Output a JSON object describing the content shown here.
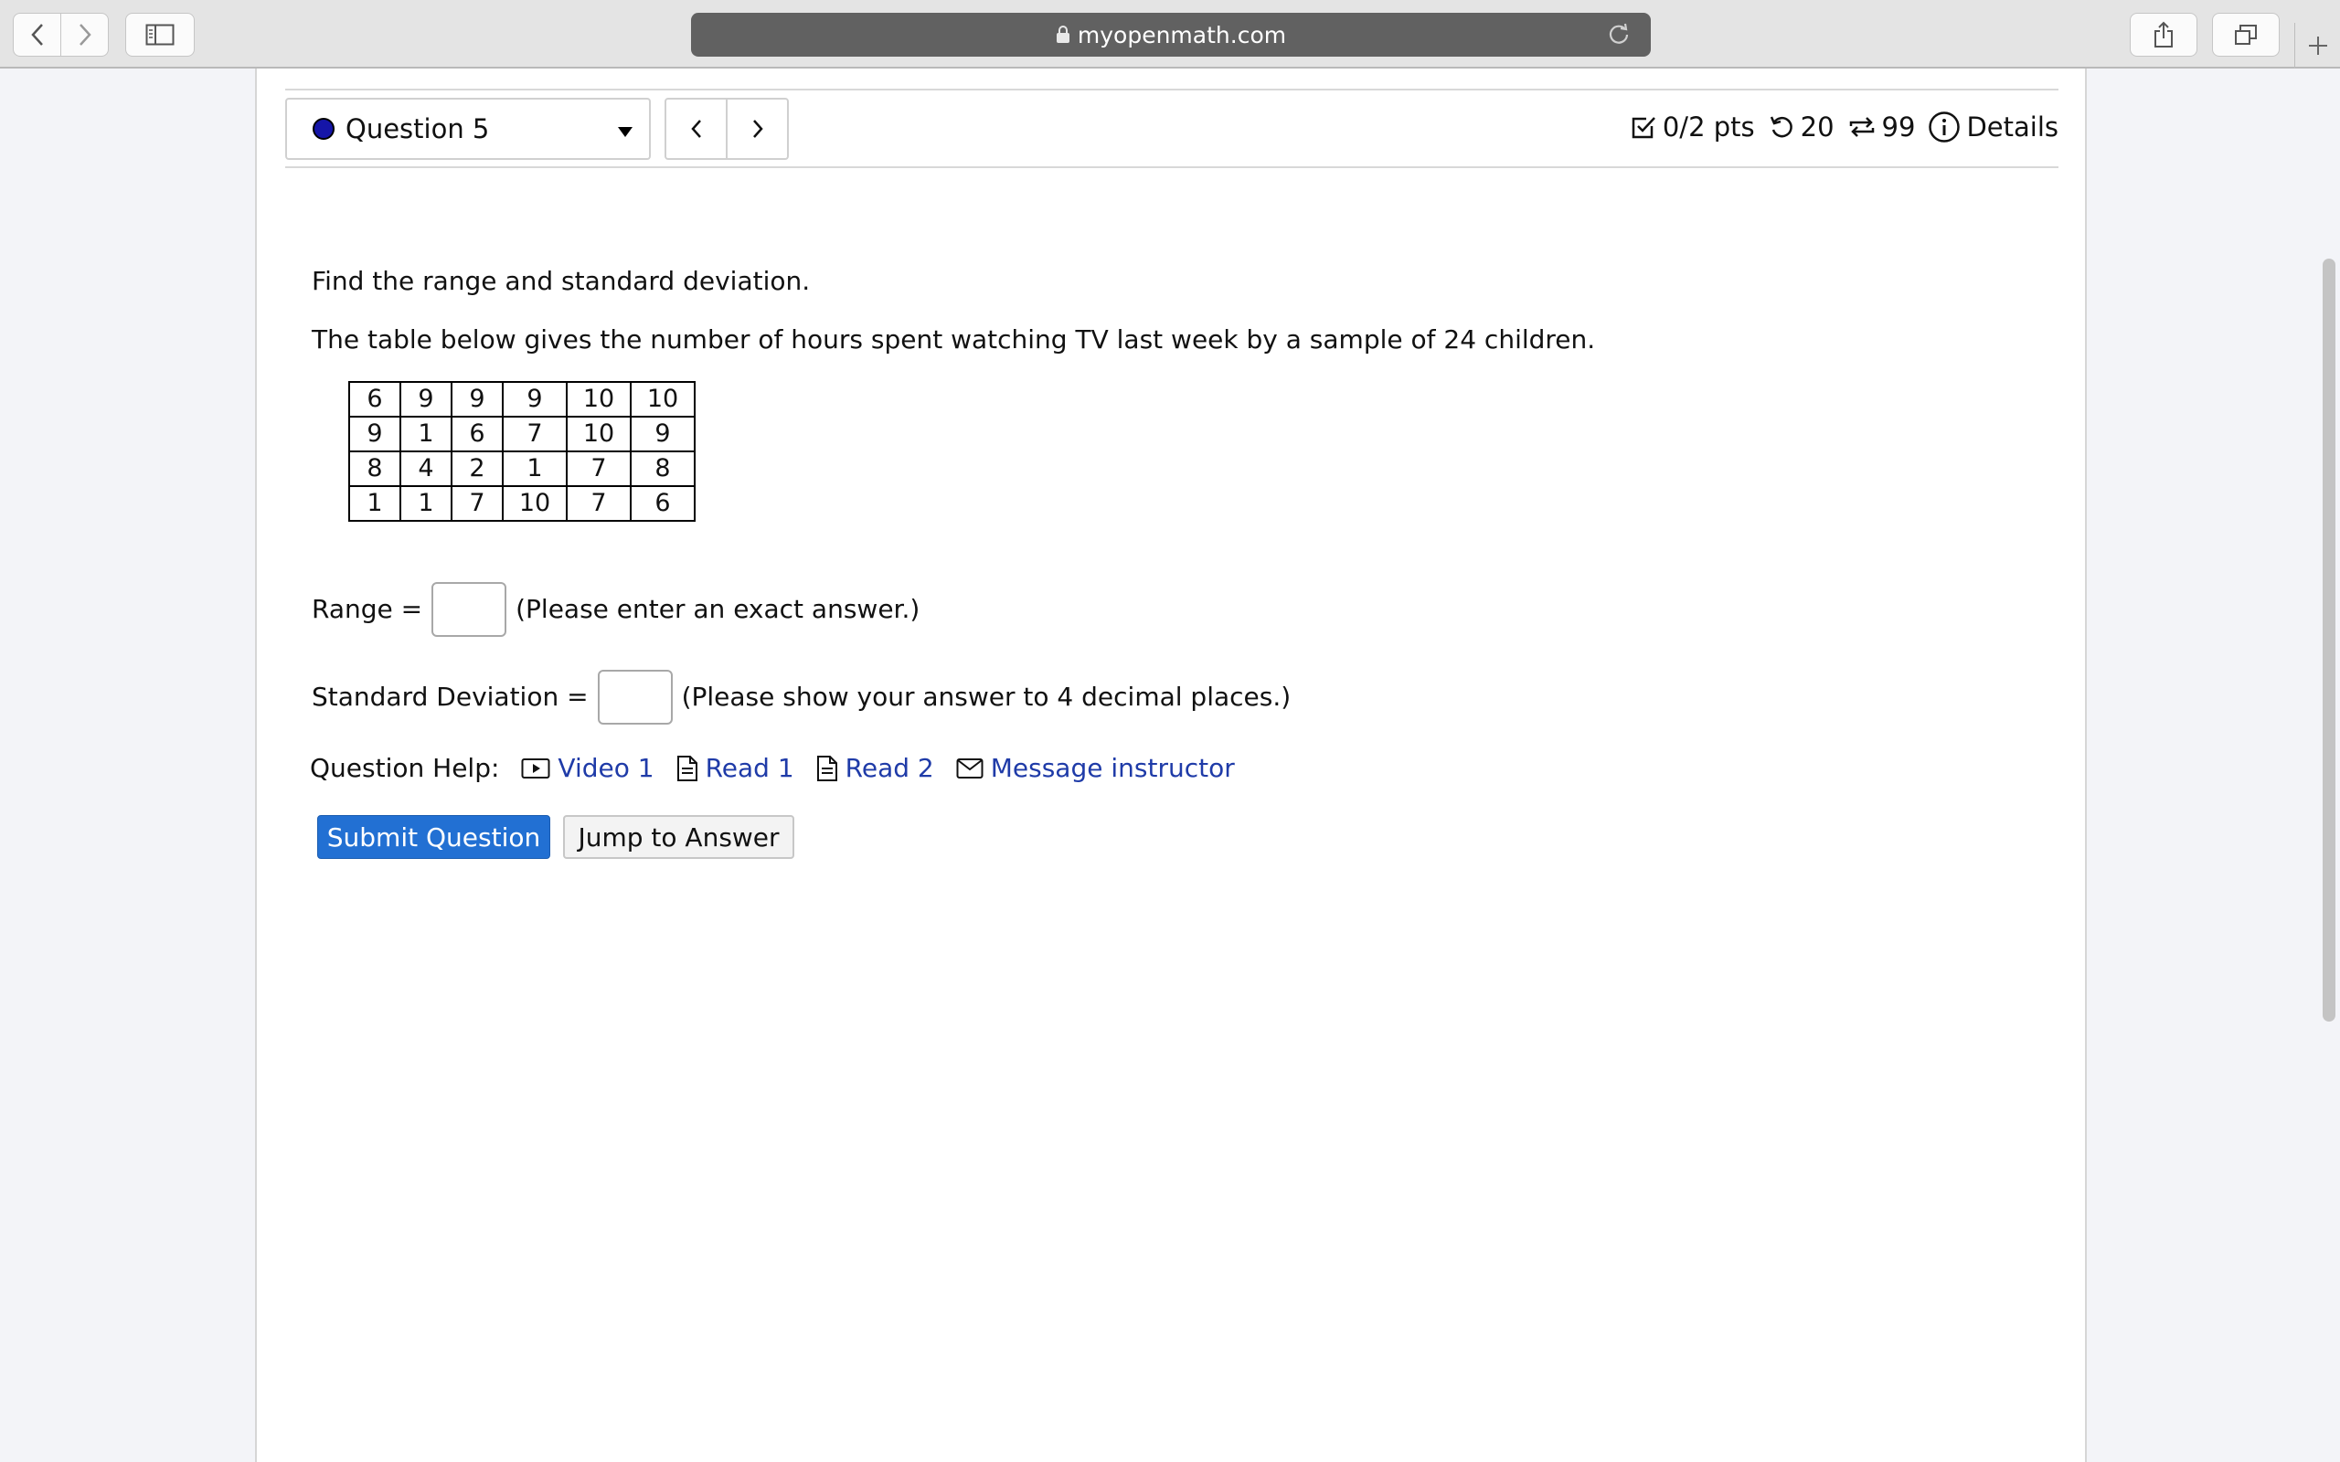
{
  "browser": {
    "url": "myopenmath.com"
  },
  "question": {
    "selector_label": "Question 5",
    "points": "0/2 pts",
    "retries": "20",
    "attempts": "99",
    "details_label": "Details"
  },
  "content": {
    "instruction": "Find the range and standard deviation.",
    "description": "The table below gives the number of hours spent watching TV last week by a sample of 24 children.",
    "table": [
      [
        "6",
        "9",
        "9",
        "9",
        "10",
        "10"
      ],
      [
        "9",
        "1",
        "6",
        "7",
        "10",
        "9"
      ],
      [
        "8",
        "4",
        "2",
        "1",
        "7",
        "8"
      ],
      [
        "1",
        "1",
        "7",
        "10",
        "7",
        "6"
      ]
    ],
    "range_label": "Range =",
    "range_hint": "(Please enter an exact answer.)",
    "sd_label": "Standard Deviation =",
    "sd_hint": "(Please show your answer to 4 decimal places.)"
  },
  "help": {
    "label": "Question Help:",
    "video": "Video 1",
    "read1": "Read 1",
    "read2": "Read 2",
    "message": "Message instructor"
  },
  "buttons": {
    "submit": "Submit Question",
    "jump": "Jump to Answer"
  },
  "colors": {
    "link": "#1f3ba8",
    "submit_bg": "#2270d3",
    "question_dot": "#1515a8"
  }
}
